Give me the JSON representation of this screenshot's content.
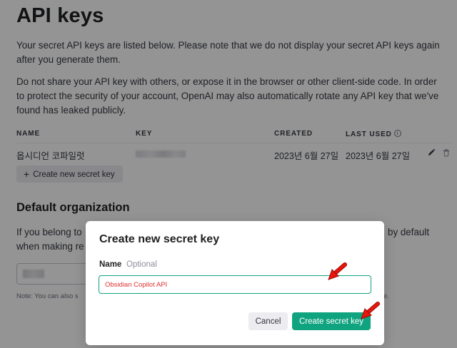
{
  "page": {
    "title": "API keys",
    "intro": "Your secret API keys are listed below. Please note that we do not display your secret API keys again after you generate them.",
    "warning": "Do not share your API key with others, or expose it in the browser or other client-side code. In order to protect the security of your account, OpenAI may also automatically rotate any API key that we've found has leaked publicly."
  },
  "table": {
    "headers": {
      "name": "NAME",
      "key": "KEY",
      "created": "CREATED",
      "last_used": "LAST USED"
    },
    "rows": [
      {
        "name": "옵시디언 코파일럿",
        "created": "2023년 6월 27일",
        "last_used": "2023년 6월 27일"
      }
    ],
    "create_button": "Create new secret key"
  },
  "default_org": {
    "title": "Default organization",
    "text_start": "If you belong to",
    "text_start_line2": "when making re",
    "text_end": "by default",
    "note_start": "Note: You can also s",
    "note_end": "e."
  },
  "modal": {
    "title": "Create new secret key",
    "name_label": "Name",
    "optional_label": "Optional",
    "input_value": "Obsidian Copilot API",
    "cancel_label": "Cancel",
    "submit_label": "Create secret key"
  },
  "colors": {
    "accent": "#10a37f",
    "annotation_arrow": "#e8160c",
    "input_text": "#e03131"
  },
  "icons": {
    "plus": "+",
    "edit": "pencil-icon",
    "delete": "trash-icon",
    "info": "info-icon"
  }
}
